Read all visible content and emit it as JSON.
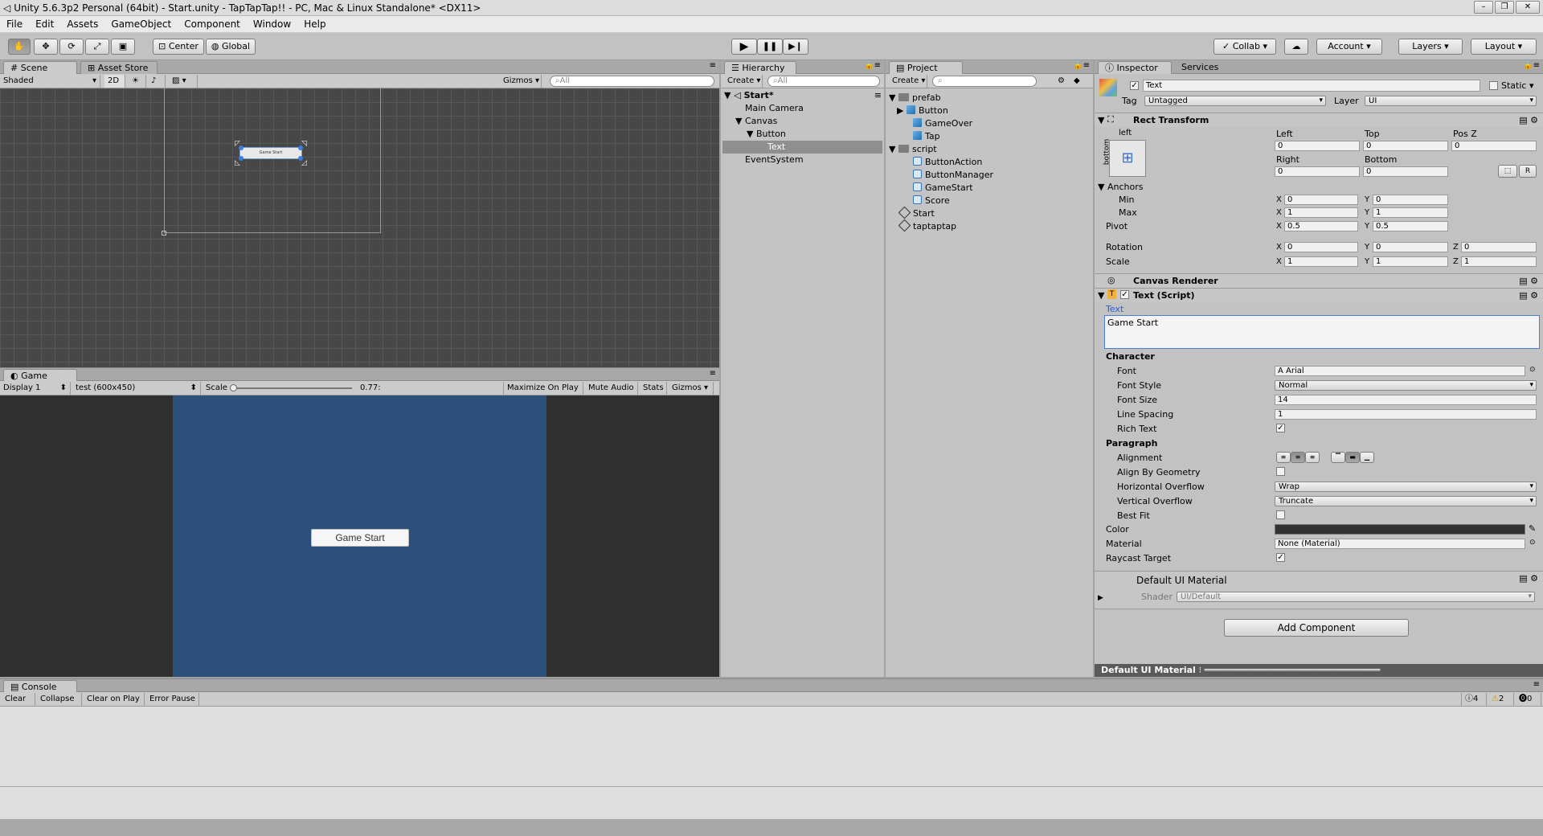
{
  "window": {
    "title": "Unity 5.6.3p2 Personal (64bit) - Start.unity - TapTapTap!! - PC, Mac & Linux Standalone* <DX11>",
    "controls": [
      "–",
      "❐",
      "✕"
    ]
  },
  "menu": [
    "File",
    "Edit",
    "Assets",
    "GameObject",
    "Component",
    "Window",
    "Help"
  ],
  "toolbar": {
    "pivot": "Center",
    "space": "Global",
    "collab": "Collab",
    "account": "Account",
    "layers": "Layers",
    "layout": "Layout"
  },
  "scene": {
    "tab": "Scene",
    "store_tab": "Asset Store",
    "shading": "Shaded",
    "mode2d": "2D",
    "gizmos": "Gizmos",
    "search": "All",
    "button_text": "Game Start"
  },
  "game": {
    "tab": "Game",
    "display": "Display 1",
    "resolution": "test (600x450)",
    "scale_label": "Scale",
    "scale_value": "0.77:",
    "maximize": "Maximize On Play",
    "mute": "Mute Audio",
    "stats": "Stats",
    "gizmos": "Gizmos",
    "button_text": "Game Start",
    "bg_color": "#2c4f7c"
  },
  "hierarchy": {
    "tab": "Hierarchy",
    "create": "Create",
    "search": "All",
    "scene": "Start*",
    "items": [
      "Main Camera",
      "Canvas",
      "Button",
      "Text",
      "EventSystem"
    ]
  },
  "project": {
    "tab": "Project",
    "create": "Create",
    "folders": {
      "prefab": "prefab",
      "prefab_items": [
        "Button",
        "GameOver",
        "Tap"
      ],
      "script": "script",
      "script_items": [
        "ButtonAction",
        "ButtonManager",
        "GameStart",
        "Score"
      ],
      "scenes": [
        "Start",
        "taptaptap"
      ]
    }
  },
  "inspector": {
    "tab": "Inspector",
    "services_tab": "Services",
    "object_name": "Text",
    "static": "Static",
    "tag_label": "Tag",
    "tag": "Untagged",
    "layer_label": "Layer",
    "layer": "UI",
    "rect": {
      "title": "Rect Transform",
      "anchor_h": "left",
      "anchor_v": "bottom",
      "left_label": "Left",
      "top_label": "Top",
      "posz_label": "Pos Z",
      "left": "0",
      "top": "0",
      "posz": "0",
      "right_label": "Right",
      "bottom_label": "Bottom",
      "right": "0",
      "bottom": "0",
      "anchors": "Anchors",
      "min": "Min",
      "max": "Max",
      "min_x": "0",
      "min_y": "0",
      "max_x": "1",
      "max_y": "1",
      "pivot": "Pivot",
      "pivot_x": "0.5",
      "pivot_y": "0.5",
      "rotation": "Rotation",
      "rot_x": "0",
      "rot_y": "0",
      "rot_z": "0",
      "scale": "Scale",
      "scale_x": "1",
      "scale_y": "1",
      "scale_z": "1"
    },
    "canvas_renderer": "Canvas Renderer",
    "text_script": {
      "title": "Text (Script)",
      "text_label": "Text",
      "text_value": "Game Start",
      "character": "Character",
      "font_label": "Font",
      "font": "Arial",
      "font_style_label": "Font Style",
      "font_style": "Normal",
      "font_size_label": "Font Size",
      "font_size": "14",
      "line_spacing_label": "Line Spacing",
      "line_spacing": "1",
      "rich_text_label": "Rich Text",
      "paragraph": "Paragraph",
      "alignment_label": "Alignment",
      "align_geom_label": "Align By Geometry",
      "h_overflow_label": "Horizontal Overflow",
      "h_overflow": "Wrap",
      "v_overflow_label": "Vertical Overflow",
      "v_overflow": "Truncate",
      "best_fit_label": "Best Fit",
      "color_label": "Color",
      "material_label": "Material",
      "material": "None (Material)",
      "raycast_label": "Raycast Target"
    },
    "material_section": {
      "title": "Default UI Material",
      "shader_label": "Shader",
      "shader": "UI/Default"
    },
    "add_component": "Add Component",
    "preview_label": "Default UI Material"
  },
  "console": {
    "tab": "Console",
    "buttons": [
      "Clear",
      "Collapse",
      "Clear on Play",
      "Error Pause"
    ],
    "info_count": "4",
    "warn_count": "2",
    "error_count": "0"
  }
}
